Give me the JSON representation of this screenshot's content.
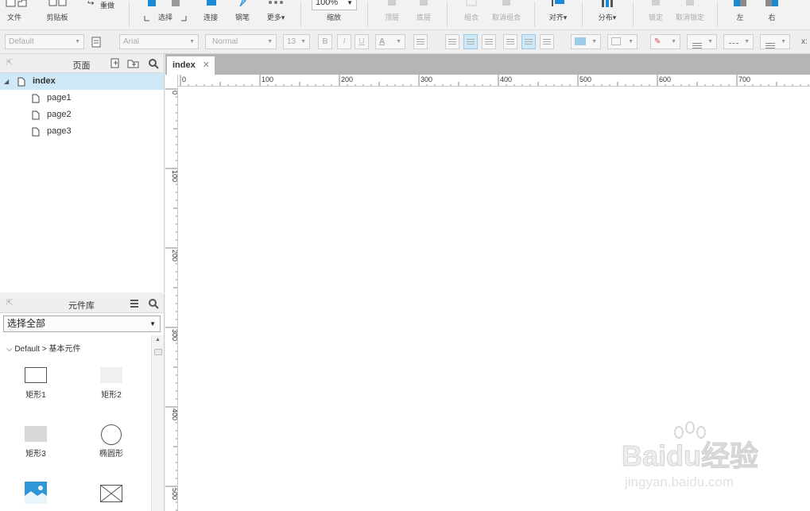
{
  "toolbar": {
    "file": "文件",
    "clipboard": "剪贴板",
    "redo": "重做",
    "select": "选择",
    "connect": "连接",
    "pen": "钢笔",
    "more": "更多",
    "zoom_value": "100%",
    "zoom": "缩放",
    "top_layer": "顶层",
    "bottom_layer": "底层",
    "group": "组合",
    "ungroup": "取消组合",
    "align": "对齐",
    "distribute": "分布",
    "lock": "锁定",
    "unlock": "取消锁定",
    "left": "左",
    "right": "右"
  },
  "format": {
    "style": "Default",
    "font": "Arial",
    "weight": "Normal",
    "size": "13",
    "bold": "B",
    "italic": "I",
    "underline": "U",
    "font_color": "A",
    "x_label": "x:"
  },
  "pages_panel": {
    "title": "页面",
    "pages": [
      {
        "label": "index",
        "selected": true
      },
      {
        "label": "page1"
      },
      {
        "label": "page2"
      },
      {
        "label": "page3"
      }
    ]
  },
  "library": {
    "title": "元件库",
    "select_value": "选择全部",
    "category": "Default > 基本元件",
    "items": [
      {
        "label": "矩形1"
      },
      {
        "label": "矩形2"
      },
      {
        "label": "矩形3"
      },
      {
        "label": "椭圆形"
      }
    ]
  },
  "canvas": {
    "tab": "index",
    "h_ticks": [
      "0",
      "100",
      "200",
      "300",
      "400",
      "500",
      "600",
      "700"
    ],
    "v_ticks": [
      "0",
      "100",
      "200",
      "300",
      "400",
      "500"
    ]
  },
  "watermark": {
    "brand": "Baidu经验",
    "url": "jingyan.baidu.com"
  },
  "colors": {
    "selection": "#cfe8f7",
    "accent": "#1a8ad4",
    "tab_bar": "#b5b5b5"
  }
}
